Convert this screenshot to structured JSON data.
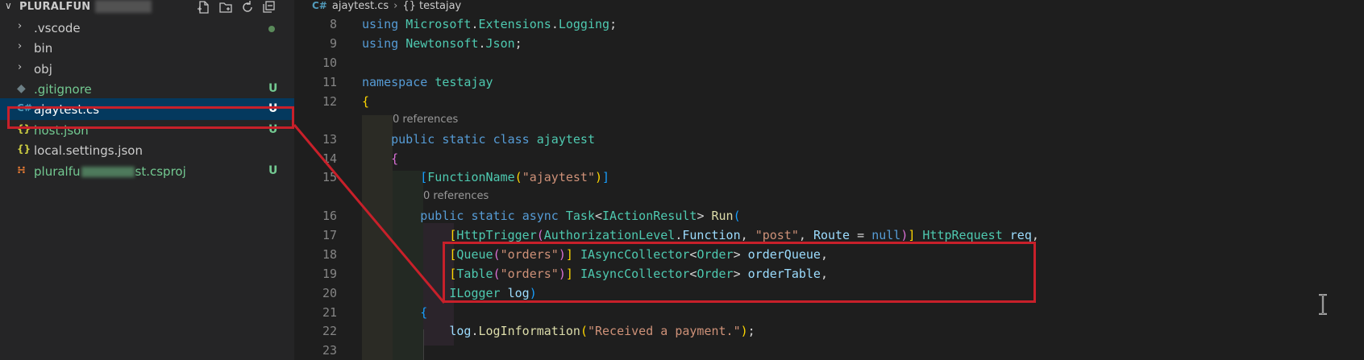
{
  "explorer": {
    "project_title": "PLURALFUN",
    "items": [
      {
        "label": ".vscode",
        "kind": "folder",
        "status": ""
      },
      {
        "label": "bin",
        "kind": "folder",
        "status": ""
      },
      {
        "label": "obj",
        "kind": "folder",
        "status": ""
      },
      {
        "label": ".gitignore",
        "kind": "file",
        "status": "U"
      },
      {
        "label": "ajaytest.cs",
        "kind": "csharp",
        "status": "U"
      },
      {
        "label": "host.json",
        "kind": "json",
        "status": "U"
      },
      {
        "label": "local.settings.json",
        "kind": "json",
        "status": ""
      },
      {
        "label_start": "pluralfu",
        "label_end": "st.csproj",
        "kind": "csproj",
        "status": "U"
      }
    ],
    "json_glyph": "{}",
    "cs_glyph": "C#"
  },
  "breadcrumb": {
    "file": "ajaytest.cs",
    "symbol_glyph": "{}",
    "symbol": "testajay"
  },
  "editor": {
    "codelens": "0 references",
    "line_numbers": [
      "8",
      "9",
      "10",
      "11",
      "12",
      "13",
      "14",
      "15",
      "16",
      "17",
      "18",
      "19",
      "20",
      "21",
      "22",
      "23"
    ]
  },
  "colors": {
    "selection": "#04395e",
    "untracked": "#73c991",
    "annotation": "#c8202a"
  }
}
